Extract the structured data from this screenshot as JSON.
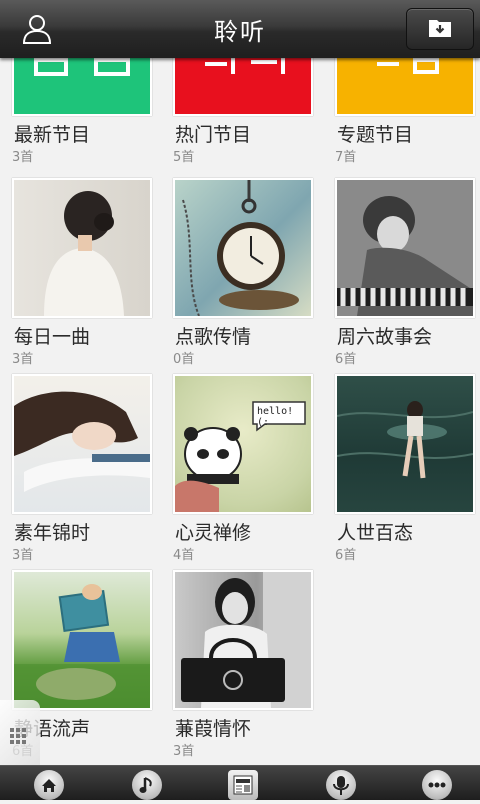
{
  "header": {
    "title": "聆听"
  },
  "tiles": [
    {
      "name": "最新节目",
      "count": "3首"
    },
    {
      "name": "热门节目",
      "count": "5首"
    },
    {
      "name": "专题节目",
      "count": "7首"
    },
    {
      "name": "每日一曲",
      "count": "3首"
    },
    {
      "name": "点歌传情",
      "count": "0首"
    },
    {
      "name": "周六故事会",
      "count": "6首"
    },
    {
      "name": "素年锦时",
      "count": "3首"
    },
    {
      "name": "心灵禅修",
      "count": "4首"
    },
    {
      "name": "人世百态",
      "count": "6首"
    },
    {
      "name": "静语流声",
      "count": "6首"
    },
    {
      "name": "蒹葭情怀",
      "count": "3首"
    }
  ],
  "bubble_text": "hello! (:",
  "bottom_nav": [
    {
      "icon": "home-icon"
    },
    {
      "icon": "music-note-icon"
    },
    {
      "icon": "news-icon"
    },
    {
      "icon": "microphone-icon"
    },
    {
      "icon": "more-icon"
    }
  ],
  "colors": {
    "tile_green": "#1ec47a",
    "tile_red": "#e8101e",
    "tile_orange": "#f7b200"
  }
}
